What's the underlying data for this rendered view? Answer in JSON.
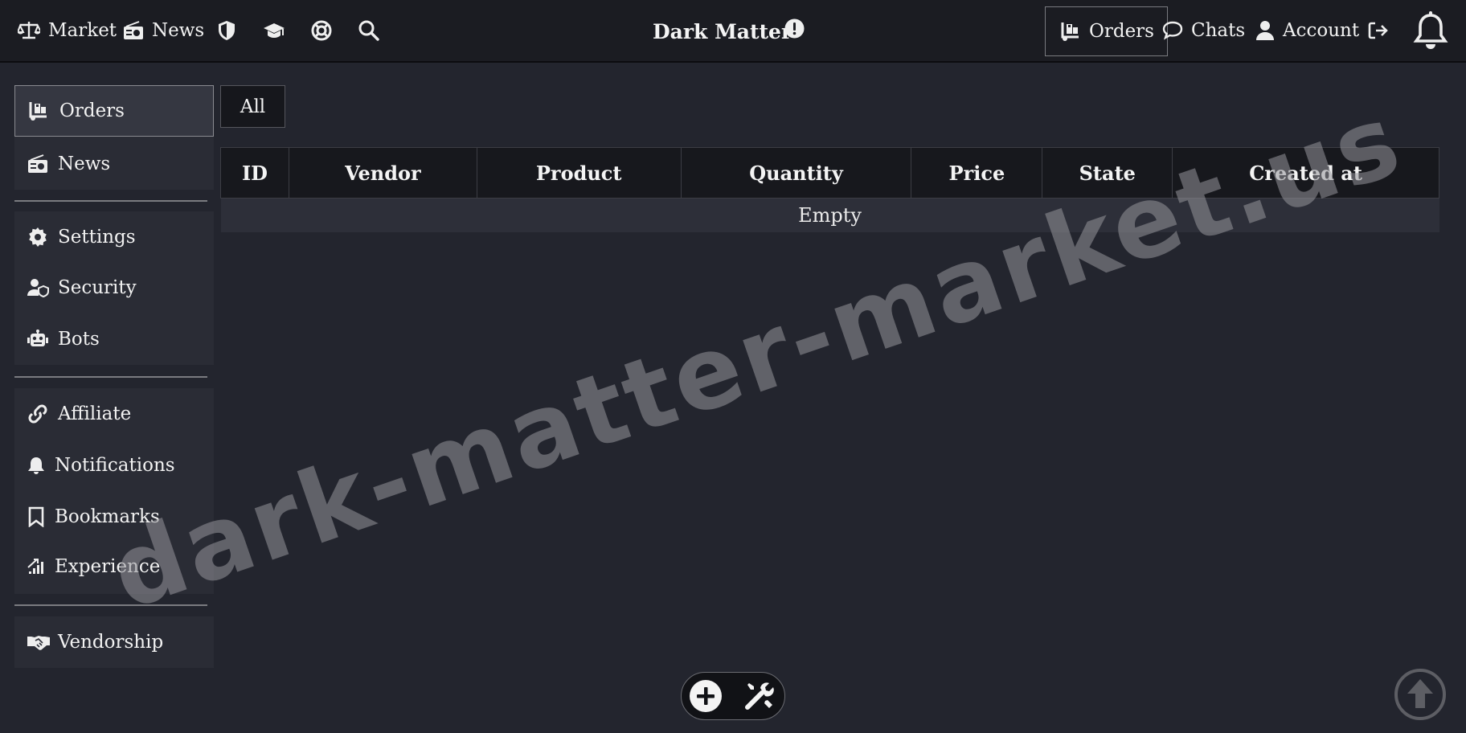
{
  "topnav": {
    "market": "Market",
    "news": "News",
    "brand": "Dark Matter",
    "orders": "Orders",
    "chats": "Chats",
    "account": "Account"
  },
  "sidebar": {
    "orders": "Orders",
    "news": "News",
    "settings": "Settings",
    "security": "Security",
    "bots": "Bots",
    "affiliate": "Affiliate",
    "notifications": "Notifications",
    "bookmarks": "Bookmarks",
    "experience": "Experience",
    "vendorship": "Vendorship"
  },
  "filter": {
    "all": "All"
  },
  "table": {
    "headers": [
      "ID",
      "Vendor",
      "Product",
      "Quantity",
      "Price",
      "State",
      "Created at"
    ],
    "empty_text": "Empty"
  },
  "watermark": "dark-matter-market.us",
  "colors": {
    "background": "#23252e",
    "topbar": "#1b1c22",
    "sidebar": "#2a2c35",
    "table_header": "#17181d",
    "table_row": "#2d2f39",
    "text": "#f2f2f2"
  },
  "icons": {
    "market": "balance-scale-icon",
    "news": "radio-icon",
    "shield": "shield-icon",
    "education": "graduation-cap-icon",
    "support": "life-ring-icon",
    "search": "search-icon",
    "info": "exclamation-circle-icon",
    "orders": "dolly-cart-icon",
    "chats": "chat-bubble-icon",
    "account": "user-icon",
    "logout": "sign-out-icon",
    "notifications": "bell-icon",
    "settings": "gear-icon",
    "security": "user-shield-icon",
    "bots": "robot-icon",
    "affiliate": "link-icon",
    "bookmarks": "bookmark-icon",
    "experience": "chart-growth-icon",
    "vendorship": "handshake-icon",
    "add": "plus-circle-icon",
    "tools": "tools-icon",
    "scroll_top": "arrow-up-circle-icon"
  }
}
